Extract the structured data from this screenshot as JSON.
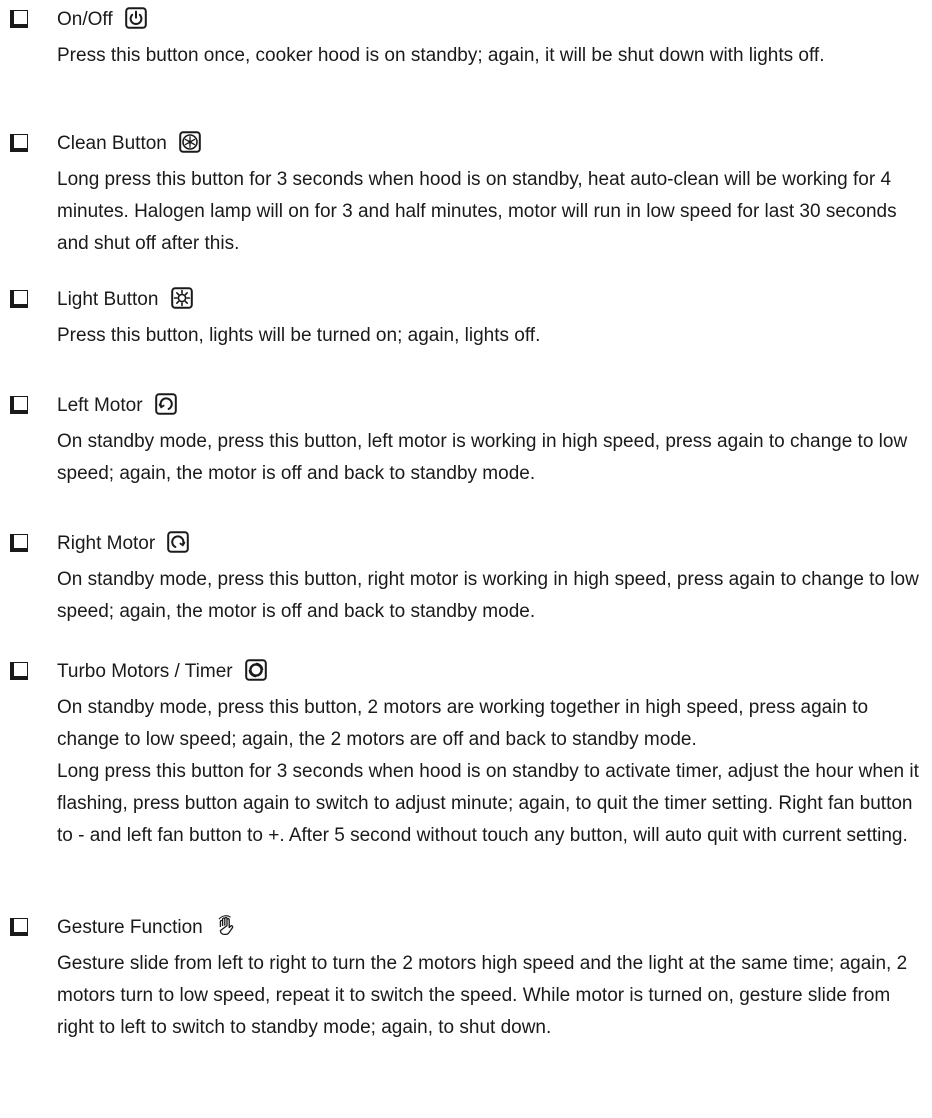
{
  "sections": [
    {
      "title": "On/Off",
      "icon": "power-icon",
      "paragraphs": [
        "Press this button once, cooker hood is on standby; again, it will be shut down with lights off."
      ]
    },
    {
      "title": "Clean Button",
      "icon": "fan-clean-icon",
      "paragraphs": [
        "Long press this button for 3 seconds when hood is on standby, heat auto-clean will be working for 4 minutes. Halogen lamp will on for 3 and half minutes, motor will run in low speed for last 30 seconds and shut off after this."
      ]
    },
    {
      "title": "Light Button",
      "icon": "light-icon",
      "paragraphs": [
        "Press this button, lights will be turned on; again, lights off."
      ]
    },
    {
      "title": "Left Motor",
      "icon": "left-motor-icon",
      "paragraphs": [
        "On standby mode, press this button, left motor is working in high speed, press again to change to low speed; again, the motor is off and back to standby mode."
      ]
    },
    {
      "title": "Right Motor",
      "icon": "right-motor-icon",
      "paragraphs": [
        "On standby mode, press this button, right motor is working in high speed, press again to change to low speed; again, the motor is off and back to standby mode."
      ]
    },
    {
      "title": "Turbo Motors / Timer",
      "icon": "turbo-motor-icon",
      "paragraphs": [
        "On standby mode, press this button, 2 motors are working together in high speed, press again to change to low speed; again, the 2 motors are off and back to standby mode.",
        "Long press this button for 3 seconds when hood is on standby to activate timer, adjust the hour when it flashing, press button again to switch to adjust minute; again, to quit the timer setting. Right fan button to - and left fan button to +. After 5 second without touch any button, will auto quit with current setting."
      ]
    },
    {
      "title": "Gesture Function",
      "icon": "gesture-hand-icon",
      "paragraphs": [
        "Gesture slide from left to right to turn the 2 motors high speed and the light at the same time; again, 2 motors turn to low speed, repeat it to switch the speed. While motor is turned on, gesture slide from right to left to switch to standby mode; again, to shut down."
      ]
    }
  ]
}
